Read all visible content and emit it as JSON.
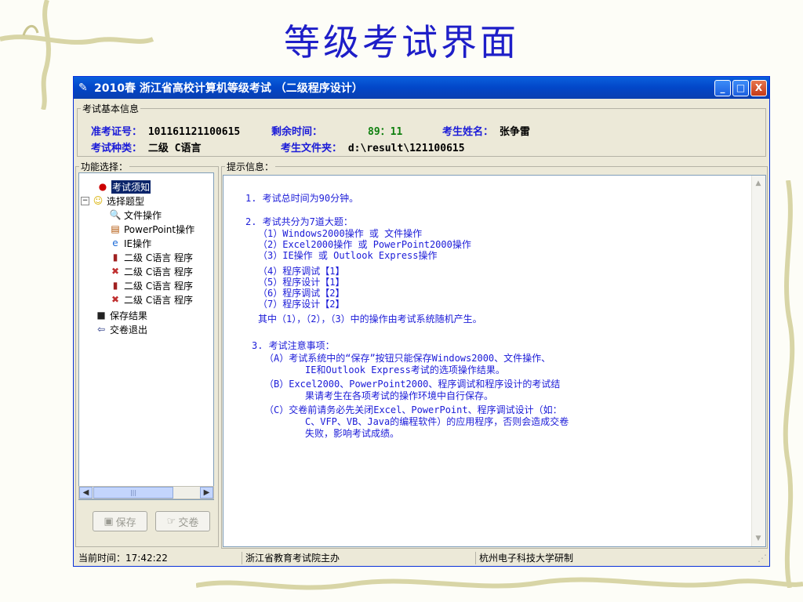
{
  "slide": {
    "title": "等级考试界面"
  },
  "window": {
    "title": "2010春 浙江省高校计算机等级考试 （二级程序设计）",
    "controls": {
      "minimize": "_",
      "maximize": "□",
      "close": "X"
    }
  },
  "basic_info": {
    "label": "考试基本信息",
    "exam_id_label": "准考证号：",
    "exam_id": "101161121100615",
    "time_left_label": "剩余时间：",
    "time_left": "89：11",
    "name_label": "考生姓名：",
    "name": "张争雷",
    "exam_type_label": "考试种类：",
    "exam_type": "二级 C语言",
    "folder_label": "考生文件夹：",
    "folder": "d:\\result\\121100615"
  },
  "functions": {
    "label": "功能选择：",
    "items": [
      {
        "label": "考试须知",
        "icon": "traffic-light-icon"
      },
      {
        "label": "选择题型",
        "icon": "smiley-icon"
      },
      {
        "label": "文件操作",
        "icon": "search-folder-icon"
      },
      {
        "label": "PowerPoint操作",
        "icon": "powerpoint-icon"
      },
      {
        "label": "IE操作",
        "icon": "ie-icon"
      },
      {
        "label": "二级 C语言 程序",
        "icon": "program-debug-icon"
      },
      {
        "label": "二级 C语言 程序",
        "icon": "program-design-icon"
      },
      {
        "label": "二级 C语言 程序",
        "icon": "program-debug-icon"
      },
      {
        "label": "二级 C语言 程序",
        "icon": "program-design-icon"
      },
      {
        "label": "保存结果",
        "icon": "floppy-icon"
      },
      {
        "label": "交卷退出",
        "icon": "exit-arrow-icon"
      }
    ],
    "scroll_thumb": "|||",
    "save_button": "保存",
    "submit_button": "交卷"
  },
  "hints": {
    "label": "提示信息：",
    "lines": [
      "1. 考试总时间为90分钟。",
      "2. 考试共分为7道大题：",
      "（1）Windows2000操作 或 文件操作",
      "（2）Excel2000操作 或 PowerPoint2000操作",
      "（3）IE操作 或 Outlook Express操作",
      "（4）程序调试【1】",
      "（5）程序设计【1】",
      "（6）程序调试【2】",
      "（7）程序设计【2】",
      "其中（1），（2），（3）中的操作由考试系统随机产生。",
      "3. 考试注意事项：",
      "（A）考试系统中的“保存”按钮只能保存Windows2000、文件操作、",
      "IE和Outlook Express考试的选项操作结果。",
      "（B）Excel2000、PowerPoint2000、程序调试和程序设计的考试结",
      "果请考生在各项考试的操作环境中自行保存。",
      "（C）交卷前请务必先关闭Excel、PowerPoint、程序调试设计（如：",
      "C、VFP、VB、Java的编程软件）的应用程序，否则会造成交卷",
      "失败，影响考试成绩。"
    ]
  },
  "status": {
    "time_label": "当前时间：",
    "time": "17:42:22",
    "organizer": "浙江省教育考试院主办",
    "developer": "杭州电子科技大学研制"
  },
  "colors": {
    "label_blue": "#1b1bd8",
    "time_green": "#108010",
    "title_blue": "#1e1ec8",
    "titlebar": "#0246c8"
  }
}
